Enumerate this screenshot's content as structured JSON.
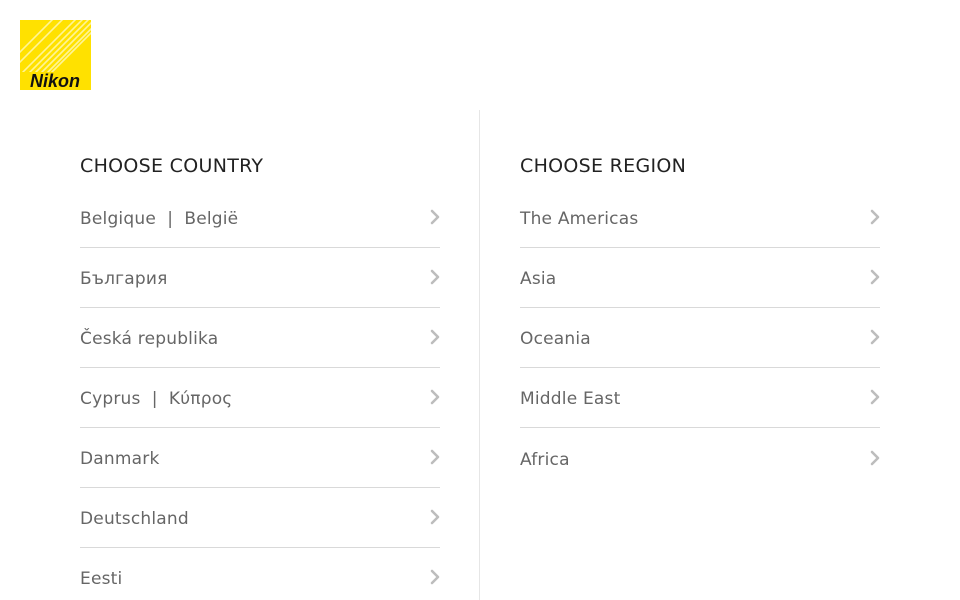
{
  "brand": {
    "logo_text": "Nikon",
    "accent": "#ffe100"
  },
  "country": {
    "title": "CHOOSE COUNTRY",
    "items": [
      {
        "label": "Belgique  |  België"
      },
      {
        "label": "България"
      },
      {
        "label": "Česká republika"
      },
      {
        "label": "Cyprus  |  Κύπρος"
      },
      {
        "label": "Danmark"
      },
      {
        "label": "Deutschland"
      },
      {
        "label": "Eesti"
      }
    ]
  },
  "region": {
    "title": "CHOOSE REGION",
    "items": [
      {
        "label": "The Americas"
      },
      {
        "label": "Asia"
      },
      {
        "label": "Oceania"
      },
      {
        "label": "Middle East"
      },
      {
        "label": "Africa"
      }
    ]
  },
  "icons": {
    "item_arrow": "chevron-right-icon"
  },
  "colors": {
    "text_title": "#222222",
    "text_item": "#666666",
    "divider": "#d9d9d9"
  }
}
